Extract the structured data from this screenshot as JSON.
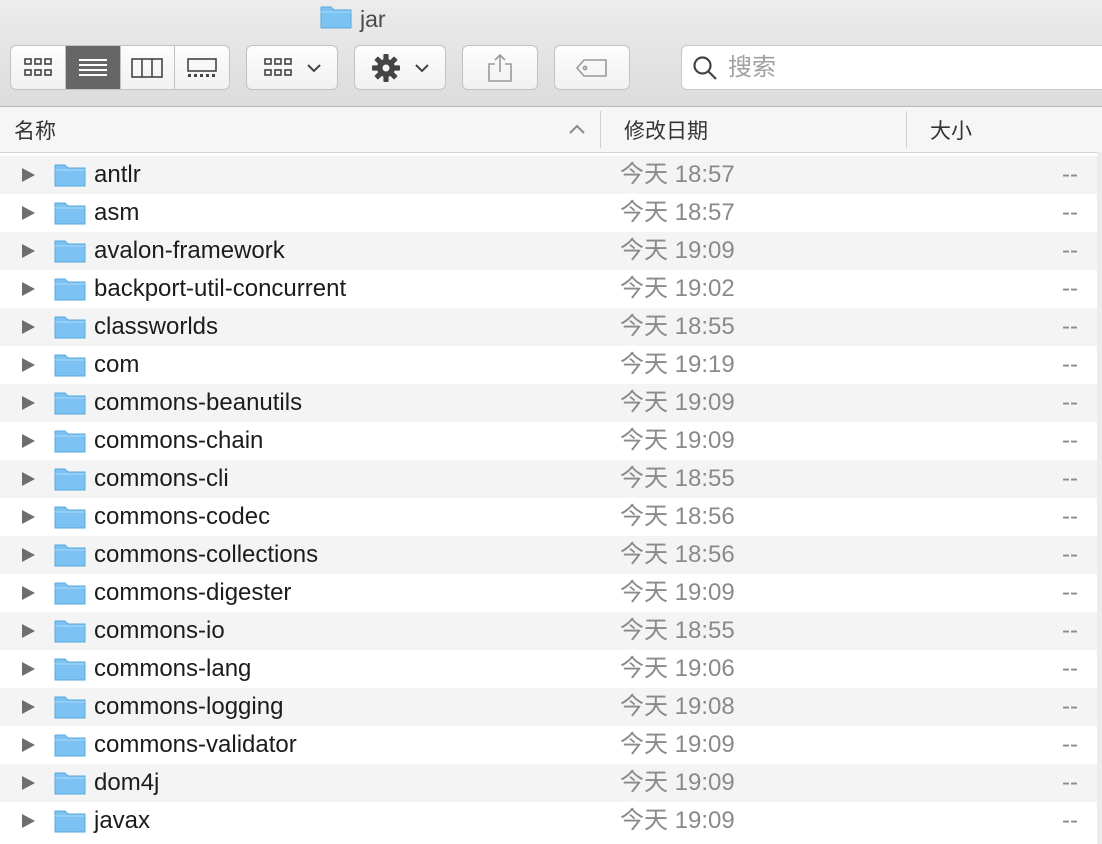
{
  "window": {
    "title": "jar"
  },
  "toolbar": {
    "view_modes": [
      "icon-view",
      "list-view",
      "column-view",
      "gallery-view"
    ],
    "active_view": "list-view",
    "search_placeholder": "搜索"
  },
  "columns": {
    "name": "名称",
    "date": "修改日期",
    "size": "大小"
  },
  "files": [
    {
      "name": "antlr",
      "date": "今天 18:57",
      "size": "--"
    },
    {
      "name": "asm",
      "date": "今天 18:57",
      "size": "--"
    },
    {
      "name": "avalon-framework",
      "date": "今天 19:09",
      "size": "--"
    },
    {
      "name": "backport-util-concurrent",
      "date": "今天 19:02",
      "size": "--"
    },
    {
      "name": "classworlds",
      "date": "今天 18:55",
      "size": "--"
    },
    {
      "name": "com",
      "date": "今天 19:19",
      "size": "--"
    },
    {
      "name": "commons-beanutils",
      "date": "今天 19:09",
      "size": "--"
    },
    {
      "name": "commons-chain",
      "date": "今天 19:09",
      "size": "--"
    },
    {
      "name": "commons-cli",
      "date": "今天 18:55",
      "size": "--"
    },
    {
      "name": "commons-codec",
      "date": "今天 18:56",
      "size": "--"
    },
    {
      "name": "commons-collections",
      "date": "今天 18:56",
      "size": "--"
    },
    {
      "name": "commons-digester",
      "date": "今天 19:09",
      "size": "--"
    },
    {
      "name": "commons-io",
      "date": "今天 18:55",
      "size": "--"
    },
    {
      "name": "commons-lang",
      "date": "今天 19:06",
      "size": "--"
    },
    {
      "name": "commons-logging",
      "date": "今天 19:08",
      "size": "--"
    },
    {
      "name": "commons-validator",
      "date": "今天 19:09",
      "size": "--"
    },
    {
      "name": "dom4j",
      "date": "今天 19:09",
      "size": "--"
    },
    {
      "name": "javax",
      "date": "今天 19:09",
      "size": "--"
    }
  ],
  "colors": {
    "folder": "#7cc3f3",
    "active_segment": "#666666",
    "alt_row": "#f4f4f4"
  }
}
